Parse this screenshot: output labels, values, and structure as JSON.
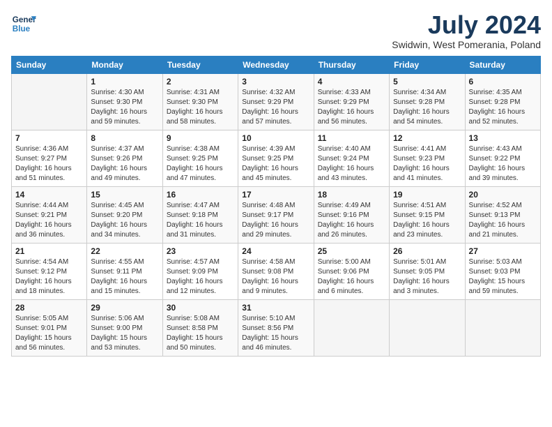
{
  "header": {
    "logo_line1": "General",
    "logo_line2": "Blue",
    "month_year": "July 2024",
    "location": "Swidwin, West Pomerania, Poland"
  },
  "days_of_week": [
    "Sunday",
    "Monday",
    "Tuesday",
    "Wednesday",
    "Thursday",
    "Friday",
    "Saturday"
  ],
  "weeks": [
    [
      {
        "day": "",
        "content": ""
      },
      {
        "day": "1",
        "content": "Sunrise: 4:30 AM\nSunset: 9:30 PM\nDaylight: 16 hours\nand 59 minutes."
      },
      {
        "day": "2",
        "content": "Sunrise: 4:31 AM\nSunset: 9:30 PM\nDaylight: 16 hours\nand 58 minutes."
      },
      {
        "day": "3",
        "content": "Sunrise: 4:32 AM\nSunset: 9:29 PM\nDaylight: 16 hours\nand 57 minutes."
      },
      {
        "day": "4",
        "content": "Sunrise: 4:33 AM\nSunset: 9:29 PM\nDaylight: 16 hours\nand 56 minutes."
      },
      {
        "day": "5",
        "content": "Sunrise: 4:34 AM\nSunset: 9:28 PM\nDaylight: 16 hours\nand 54 minutes."
      },
      {
        "day": "6",
        "content": "Sunrise: 4:35 AM\nSunset: 9:28 PM\nDaylight: 16 hours\nand 52 minutes."
      }
    ],
    [
      {
        "day": "7",
        "content": "Sunrise: 4:36 AM\nSunset: 9:27 PM\nDaylight: 16 hours\nand 51 minutes."
      },
      {
        "day": "8",
        "content": "Sunrise: 4:37 AM\nSunset: 9:26 PM\nDaylight: 16 hours\nand 49 minutes."
      },
      {
        "day": "9",
        "content": "Sunrise: 4:38 AM\nSunset: 9:25 PM\nDaylight: 16 hours\nand 47 minutes."
      },
      {
        "day": "10",
        "content": "Sunrise: 4:39 AM\nSunset: 9:25 PM\nDaylight: 16 hours\nand 45 minutes."
      },
      {
        "day": "11",
        "content": "Sunrise: 4:40 AM\nSunset: 9:24 PM\nDaylight: 16 hours\nand 43 minutes."
      },
      {
        "day": "12",
        "content": "Sunrise: 4:41 AM\nSunset: 9:23 PM\nDaylight: 16 hours\nand 41 minutes."
      },
      {
        "day": "13",
        "content": "Sunrise: 4:43 AM\nSunset: 9:22 PM\nDaylight: 16 hours\nand 39 minutes."
      }
    ],
    [
      {
        "day": "14",
        "content": "Sunrise: 4:44 AM\nSunset: 9:21 PM\nDaylight: 16 hours\nand 36 minutes."
      },
      {
        "day": "15",
        "content": "Sunrise: 4:45 AM\nSunset: 9:20 PM\nDaylight: 16 hours\nand 34 minutes."
      },
      {
        "day": "16",
        "content": "Sunrise: 4:47 AM\nSunset: 9:18 PM\nDaylight: 16 hours\nand 31 minutes."
      },
      {
        "day": "17",
        "content": "Sunrise: 4:48 AM\nSunset: 9:17 PM\nDaylight: 16 hours\nand 29 minutes."
      },
      {
        "day": "18",
        "content": "Sunrise: 4:49 AM\nSunset: 9:16 PM\nDaylight: 16 hours\nand 26 minutes."
      },
      {
        "day": "19",
        "content": "Sunrise: 4:51 AM\nSunset: 9:15 PM\nDaylight: 16 hours\nand 23 minutes."
      },
      {
        "day": "20",
        "content": "Sunrise: 4:52 AM\nSunset: 9:13 PM\nDaylight: 16 hours\nand 21 minutes."
      }
    ],
    [
      {
        "day": "21",
        "content": "Sunrise: 4:54 AM\nSunset: 9:12 PM\nDaylight: 16 hours\nand 18 minutes."
      },
      {
        "day": "22",
        "content": "Sunrise: 4:55 AM\nSunset: 9:11 PM\nDaylight: 16 hours\nand 15 minutes."
      },
      {
        "day": "23",
        "content": "Sunrise: 4:57 AM\nSunset: 9:09 PM\nDaylight: 16 hours\nand 12 minutes."
      },
      {
        "day": "24",
        "content": "Sunrise: 4:58 AM\nSunset: 9:08 PM\nDaylight: 16 hours\nand 9 minutes."
      },
      {
        "day": "25",
        "content": "Sunrise: 5:00 AM\nSunset: 9:06 PM\nDaylight: 16 hours\nand 6 minutes."
      },
      {
        "day": "26",
        "content": "Sunrise: 5:01 AM\nSunset: 9:05 PM\nDaylight: 16 hours\nand 3 minutes."
      },
      {
        "day": "27",
        "content": "Sunrise: 5:03 AM\nSunset: 9:03 PM\nDaylight: 15 hours\nand 59 minutes."
      }
    ],
    [
      {
        "day": "28",
        "content": "Sunrise: 5:05 AM\nSunset: 9:01 PM\nDaylight: 15 hours\nand 56 minutes."
      },
      {
        "day": "29",
        "content": "Sunrise: 5:06 AM\nSunset: 9:00 PM\nDaylight: 15 hours\nand 53 minutes."
      },
      {
        "day": "30",
        "content": "Sunrise: 5:08 AM\nSunset: 8:58 PM\nDaylight: 15 hours\nand 50 minutes."
      },
      {
        "day": "31",
        "content": "Sunrise: 5:10 AM\nSunset: 8:56 PM\nDaylight: 15 hours\nand 46 minutes."
      },
      {
        "day": "",
        "content": ""
      },
      {
        "day": "",
        "content": ""
      },
      {
        "day": "",
        "content": ""
      }
    ]
  ]
}
